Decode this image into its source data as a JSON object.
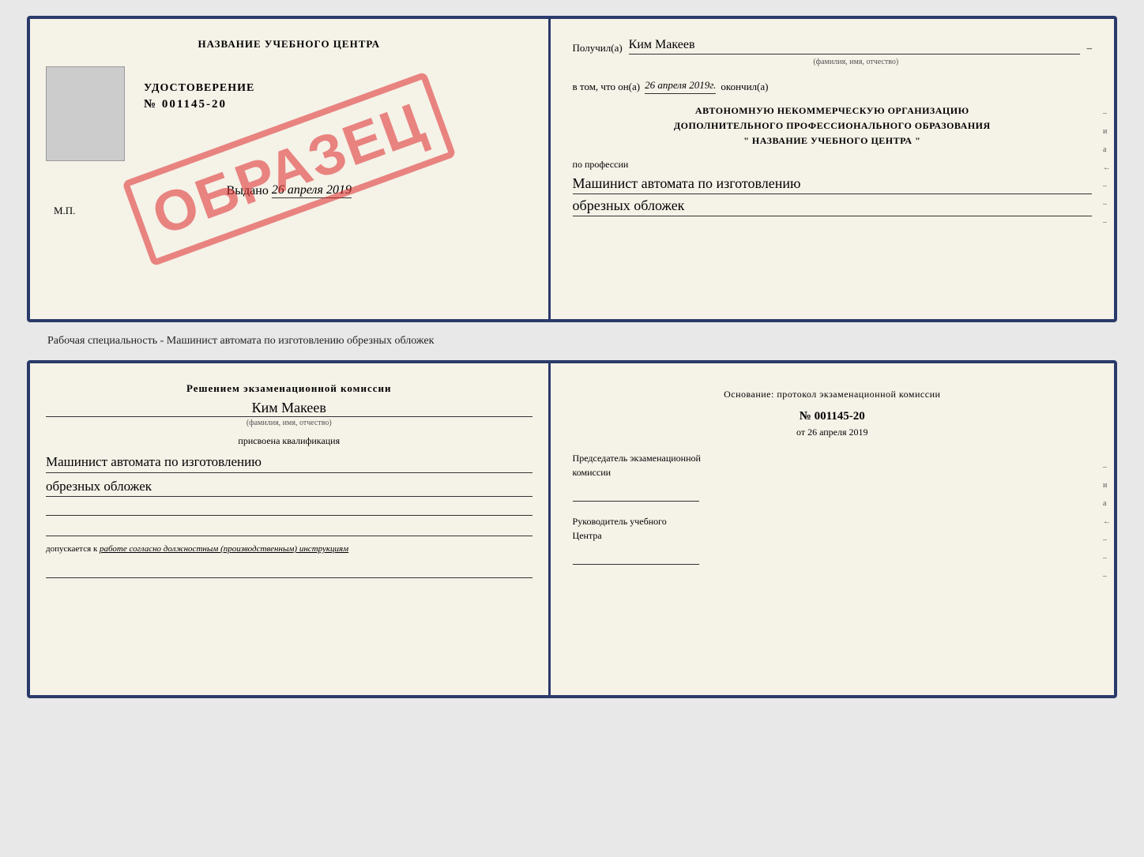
{
  "top_doc": {
    "left": {
      "school_name": "НАЗВАНИЕ УЧЕБНОГО ЦЕНТРА",
      "stamp_text": "ОБРАЗЕЦ",
      "udostoverenie_title": "УДОСТОВЕРЕНИЕ",
      "udostoverenie_number": "№ 001145-20",
      "vydano_label": "Выдано",
      "vydano_date": "26 апреля 2019",
      "mp_label": "М.П."
    },
    "right": {
      "poluchil_label": "Получил(а)",
      "poluchil_name": "Ким Макеев",
      "poluchil_dash": "–",
      "fio_label": "(фамилия, имя, отчество)",
      "vtom_label": "в том, что он(а)",
      "vtom_date": "26 апреля 2019г.",
      "okonchil_label": "окончил(а)",
      "avtonom_line1": "АВТОНОМНУЮ НЕКОММЕРЧЕСКУЮ ОРГАНИЗАЦИЮ",
      "avtonom_line2": "ДОПОЛНИТЕЛЬНОГО ПРОФЕССИОНАЛЬНОГО ОБРАЗОВАНИЯ",
      "avtonom_line3": "\"   НАЗВАНИЕ УЧЕБНОГО ЦЕНТРА   \"",
      "po_professii_label": "по профессии",
      "profession_line1": "Машинист автомата по изготовлению",
      "profession_line2": "обрезных обложек",
      "side_marks": [
        "–",
        "–",
        "и",
        "а",
        "←",
        "–",
        "–",
        "–",
        "–"
      ]
    }
  },
  "between_label": "Рабочая специальность - Машинист автомата по изготовлению обрезных обложек",
  "bottom_doc": {
    "left": {
      "resheniem_text": "Решением экзаменационной комиссии",
      "name": "Ким Макеев",
      "fio_label": "(фамилия, имя, отчество)",
      "prisvoena": "присвоена квалификация",
      "kvalif_line1": "Машинист автомата по изготовлению",
      "kvalif_line2": "обрезных обложек",
      "dopusk_prefix": "допускается к",
      "dopusk_italic": "работе согласно должностным (производственным) инструкциям"
    },
    "right": {
      "osnovanie_text": "Основание: протокол экзаменационной комиссии",
      "protocol_number": "№  001145-20",
      "ot_label": "от",
      "ot_date": "26 апреля 2019",
      "predsedatel_line1": "Председатель экзаменационной",
      "predsedatel_line2": "комиссии",
      "rukovoditel_line1": "Руководитель учебного",
      "rukovoditel_line2": "Центра",
      "side_marks": [
        "–",
        "–",
        "и",
        "а",
        "←",
        "–",
        "–",
        "–",
        "–"
      ]
    }
  }
}
